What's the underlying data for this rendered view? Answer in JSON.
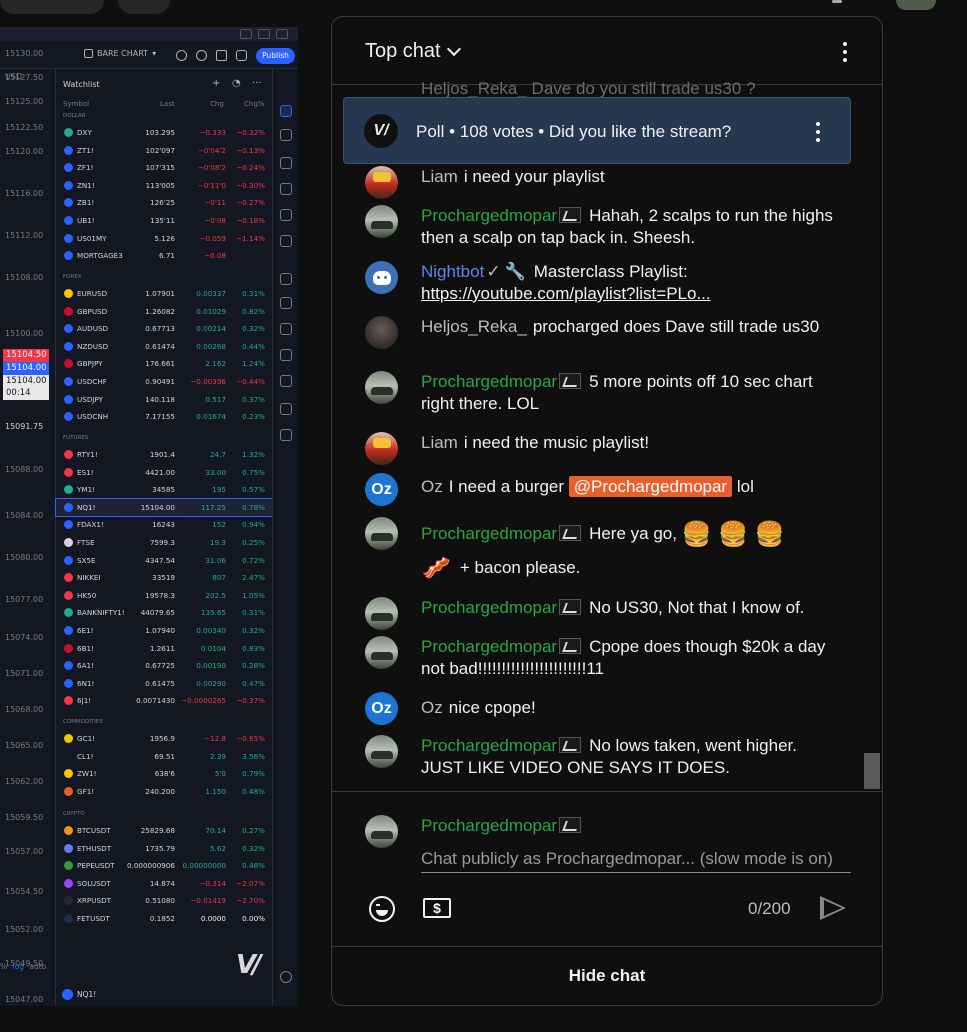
{
  "video": {
    "toolbar": {
      "bare_chart": "BARE CHART",
      "publish": "Publish"
    },
    "price_axis": {
      "currency": "USD ·",
      "labels": [
        "15130.00",
        "15127.50",
        "15125.00",
        "15122.50",
        "15120.00",
        "15116.00",
        "15112.00",
        "15108.00",
        "15100.00",
        "15096.00",
        "15091.75",
        "15088.00",
        "15084.00",
        "15080.00",
        "15077.00",
        "15074.00",
        "15071.00",
        "15068.00",
        "15065.00",
        "15062.00",
        "15059.50",
        "15057.00",
        "15054.50",
        "15052.00",
        "15049.50",
        "15047.00"
      ],
      "box_red": "15104.50",
      "box_blue": "15104.00",
      "box_white": "15104.00",
      "box_time": "00:14"
    },
    "watchlist": {
      "title": "Watchlist",
      "cols": {
        "symbol": "Symbol",
        "last": "Last",
        "chg": "Chg",
        "chgp": "Chg%"
      },
      "sections": {
        "dollar": "DOLLAR",
        "forex": "FOREX",
        "futures": "FUTURES",
        "commodities": "COMMODITIES",
        "crypto": "CRYPTO"
      },
      "rows": [
        {
          "sym": "DXY",
          "last": "103.295",
          "chg": "−0.333",
          "chgp": "−0.32%",
          "dir": "neg",
          "flag": "#22ab94"
        },
        {
          "sym": "ZT1!",
          "last": "102'097",
          "chg": "−0'04'2",
          "chgp": "−0.13%",
          "dir": "neg",
          "flag": "#2962ff"
        },
        {
          "sym": "ZF1!",
          "last": "107'315",
          "chg": "−0'08'2",
          "chgp": "−0.24%",
          "dir": "neg",
          "flag": "#2962ff"
        },
        {
          "sym": "ZN1!",
          "last": "113'005",
          "chg": "−0'11'0",
          "chgp": "−0.30%",
          "dir": "neg",
          "flag": "#2962ff"
        },
        {
          "sym": "ZB1!",
          "last": "126'25",
          "chg": "−0'11",
          "chgp": "−0.27%",
          "dir": "neg",
          "flag": "#2962ff"
        },
        {
          "sym": "UB1!",
          "last": "135'11",
          "chg": "−0'08",
          "chgp": "−0.18%",
          "dir": "neg",
          "flag": "#2962ff"
        },
        {
          "sym": "US01MY",
          "last": "5.126",
          "chg": "−0.059",
          "chgp": "−1.14%",
          "dir": "neg",
          "flag": "#2962ff"
        },
        {
          "sym": "MORTGAGE3",
          "last": "6.71",
          "chg": "−0.08",
          "chgp": "",
          "dir": "neg",
          "flag": "#2962ff"
        },
        {
          "sym": "EURUSD",
          "last": "1.07901",
          "chg": "0.00337",
          "chgp": "0.31%",
          "dir": "pos",
          "flag": "#f7c400"
        },
        {
          "sym": "GBPUSD",
          "last": "1.26082",
          "chg": "0.01029",
          "chgp": "0.82%",
          "dir": "pos",
          "flag": "#c8102e"
        },
        {
          "sym": "AUDUSD",
          "last": "0.67713",
          "chg": "0.00214",
          "chgp": "0.32%",
          "dir": "pos",
          "flag": "#2962ff"
        },
        {
          "sym": "NZDUSD",
          "last": "0.61474",
          "chg": "0.00268",
          "chgp": "0.44%",
          "dir": "pos",
          "flag": "#2962ff"
        },
        {
          "sym": "GBPJPY",
          "last": "176.661",
          "chg": "2.162",
          "chgp": "1.24%",
          "dir": "pos",
          "flag": "#c8102e"
        },
        {
          "sym": "USDCHF",
          "last": "0.90491",
          "chg": "−0.00396",
          "chgp": "−0.44%",
          "dir": "neg",
          "flag": "#2962ff"
        },
        {
          "sym": "USDJPY",
          "last": "140.118",
          "chg": "0.517",
          "chgp": "0.37%",
          "dir": "pos",
          "flag": "#2962ff"
        },
        {
          "sym": "USDCNH",
          "last": "7.17155",
          "chg": "0.01674",
          "chgp": "0.23%",
          "dir": "pos",
          "flag": "#2962ff"
        },
        {
          "sym": "RTY1!",
          "last": "1901.4",
          "chg": "24.7",
          "chgp": "1.32%",
          "dir": "pos",
          "flag": "#f23645"
        },
        {
          "sym": "ES1!",
          "last": "4421.00",
          "chg": "33.00",
          "chgp": "0.75%",
          "dir": "pos",
          "flag": "#f23645"
        },
        {
          "sym": "YM1!",
          "last": "34585",
          "chg": "195",
          "chgp": "0.57%",
          "dir": "pos",
          "flag": "#22ab94"
        },
        {
          "sym": "NQ1!",
          "last": "15104.00",
          "chg": "117.25",
          "chgp": "0.78%",
          "dir": "pos",
          "flag": "#2962ff",
          "sel": true
        },
        {
          "sym": "FDAX1!",
          "last": "16243",
          "chg": "152",
          "chgp": "0.94%",
          "dir": "pos",
          "flag": "#2962ff"
        },
        {
          "sym": "FTSE",
          "last": "7599.3",
          "chg": "19.3",
          "chgp": "0.25%",
          "dir": "pos",
          "flag": "#d1d4dc"
        },
        {
          "sym": "SX5E",
          "last": "4347.54",
          "chg": "31.06",
          "chgp": "0.72%",
          "dir": "pos",
          "flag": "#2962ff"
        },
        {
          "sym": "NIKKEI",
          "last": "33519",
          "chg": "807",
          "chgp": "2.47%",
          "dir": "pos",
          "flag": "#f23645"
        },
        {
          "sym": "HK50",
          "last": "19578.3",
          "chg": "202.5",
          "chgp": "1.05%",
          "dir": "pos",
          "flag": "#f23645"
        },
        {
          "sym": "BANKNIFTY1!",
          "last": "44079.65",
          "chg": "135.65",
          "chgp": "0.31%",
          "dir": "pos",
          "flag": "#22ab94"
        },
        {
          "sym": "6E1!",
          "last": "1.07940",
          "chg": "0.00340",
          "chgp": "0.32%",
          "dir": "pos",
          "flag": "#2962ff"
        },
        {
          "sym": "6B1!",
          "last": "1.2611",
          "chg": "0.0104",
          "chgp": "0.83%",
          "dir": "pos",
          "flag": "#c8102e"
        },
        {
          "sym": "6A1!",
          "last": "0.67725",
          "chg": "0.00190",
          "chgp": "0.28%",
          "dir": "pos",
          "flag": "#2962ff"
        },
        {
          "sym": "6N1!",
          "last": "0.61475",
          "chg": "0.00290",
          "chgp": "0.47%",
          "dir": "pos",
          "flag": "#2962ff"
        },
        {
          "sym": "6J1!",
          "last": "0.0071430",
          "chg": "−0.0000265",
          "chgp": "−0.37%",
          "dir": "neg",
          "flag": "#f23645"
        },
        {
          "sym": "GC1!",
          "last": "1956.9",
          "chg": "−12.8",
          "chgp": "−0.65%",
          "dir": "neg",
          "flag": "#f7c400"
        },
        {
          "sym": "CL1!",
          "last": "69.51",
          "chg": "2.39",
          "chgp": "3.56%",
          "dir": "pos",
          "flag": "#131722"
        },
        {
          "sym": "ZW1!",
          "last": "638'6",
          "chg": "5'0",
          "chgp": "0.79%",
          "dir": "pos",
          "flag": "#f7c400"
        },
        {
          "sym": "GF1!",
          "last": "240.200",
          "chg": "1.150",
          "chgp": "0.48%",
          "dir": "pos",
          "flag": "#e8602c"
        },
        {
          "sym": "BTCUSDT",
          "last": "25829.68",
          "chg": "70.14",
          "chgp": "0.27%",
          "dir": "pos",
          "flag": "#f7931a"
        },
        {
          "sym": "ETHUSDT",
          "last": "1735.79",
          "chg": "5.62",
          "chgp": "0.32%",
          "dir": "pos",
          "flag": "#627eea"
        },
        {
          "sym": "PEPEUSDT",
          "last": "0.000000906",
          "chg": "0.00000000",
          "chgp": "0.48%",
          "dir": "pos",
          "flag": "#3d9a3a"
        },
        {
          "sym": "SOLUSDT",
          "last": "14.874",
          "chg": "−0.314",
          "chgp": "−2.07%",
          "dir": "neg",
          "flag": "#9945ff"
        },
        {
          "sym": "XRPUSDT",
          "last": "0.51080",
          "chg": "−0.01419",
          "chgp": "−2.70%",
          "dir": "neg",
          "flag": "#23292f"
        },
        {
          "sym": "FETUSDT",
          "last": "0.1852",
          "chg": "0.0000",
          "chgp": "0.00%",
          "dir": "neu",
          "flag": "#1d2d4a"
        }
      ]
    },
    "bottom": {
      "pct": "%",
      "log": "log",
      "auto": "auto",
      "symbol": "NQ1!"
    }
  },
  "chat": {
    "title": "Top chat",
    "ghost_line": "Heljos_Reka_  Dave do you still trade us30 ?",
    "poll": "Poll • 108 votes • Did you like the stream?",
    "messages": [
      {
        "author": "Liam",
        "text": "i need your playlist"
      },
      {
        "author": "Prochargedmopar",
        "text": "Hahah, 2 scalps to run the highs then a scalp on tap back in. Sheesh."
      },
      {
        "author": "Nightbot",
        "text": "Masterclass Playlist: ",
        "link": "https://youtube.com/playlist?list=PLo..."
      },
      {
        "author": "Heljos_Reka_",
        "text": "procharged does Dave still trade us30"
      },
      {
        "author": "Prochargedmopar",
        "text": "5 more points off 10 sec chart right there. LOL"
      },
      {
        "author": "Liam",
        "text": "i need the music playlist!"
      },
      {
        "author": "Oz",
        "text": "I need a burger ",
        "mention": "@Prochargedmopar",
        "after": " lol"
      },
      {
        "author": "Prochargedmopar",
        "text": "Here ya go, ",
        "emojis": "🍔 🍔 🍔",
        "line2_emoji": "🥓",
        "line2": "+ bacon please."
      },
      {
        "author": "Prochargedmopar",
        "text": "No US30, Not that I know of."
      },
      {
        "author": "Prochargedmopar",
        "text": "Cpope does though $20k a day not bad!!!!!!!!!!!!!!!!!!!!!!!11"
      },
      {
        "author": "Oz",
        "text": "nice cpope!"
      },
      {
        "author": "Prochargedmopar",
        "text": "No lows taken, went higher. JUST LIKE VIDEO ONE SAYS IT DOES."
      }
    ],
    "avatar_initials": {
      "oz": "Oz"
    },
    "composer": {
      "name": "Prochargedmopar",
      "placeholder": "Chat publicly as Prochargedmopar... (slow mode is on)",
      "counter": "0/200",
      "dollar": "$"
    },
    "hide_chat": "Hide chat"
  }
}
